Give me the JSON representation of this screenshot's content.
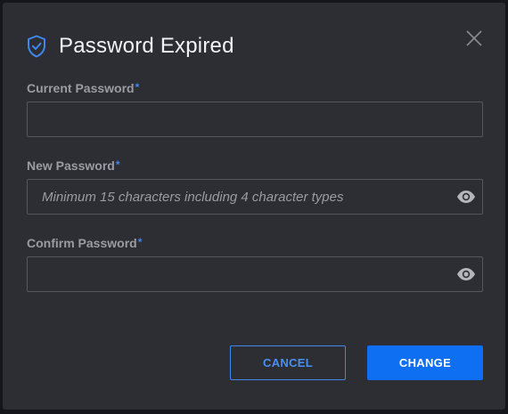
{
  "dialog": {
    "title": "Password Expired",
    "icon": "shield-check-icon",
    "close_icon": "close-icon"
  },
  "fields": {
    "current": {
      "label": "Current Password",
      "required_marker": "*",
      "value": "",
      "placeholder": ""
    },
    "new": {
      "label": "New Password",
      "required_marker": "*",
      "value": "",
      "placeholder": "Minimum 15 characters including 4 character types",
      "toggle_icon": "eye-icon"
    },
    "confirm": {
      "label": "Confirm Password",
      "required_marker": "*",
      "value": "",
      "placeholder": "",
      "toggle_icon": "eye-icon"
    }
  },
  "actions": {
    "cancel_label": "CANCEL",
    "change_label": "CHANGE"
  },
  "colors": {
    "accent": "#0f6ff2",
    "background": "#2d2e33",
    "required": "#3f87ec"
  }
}
